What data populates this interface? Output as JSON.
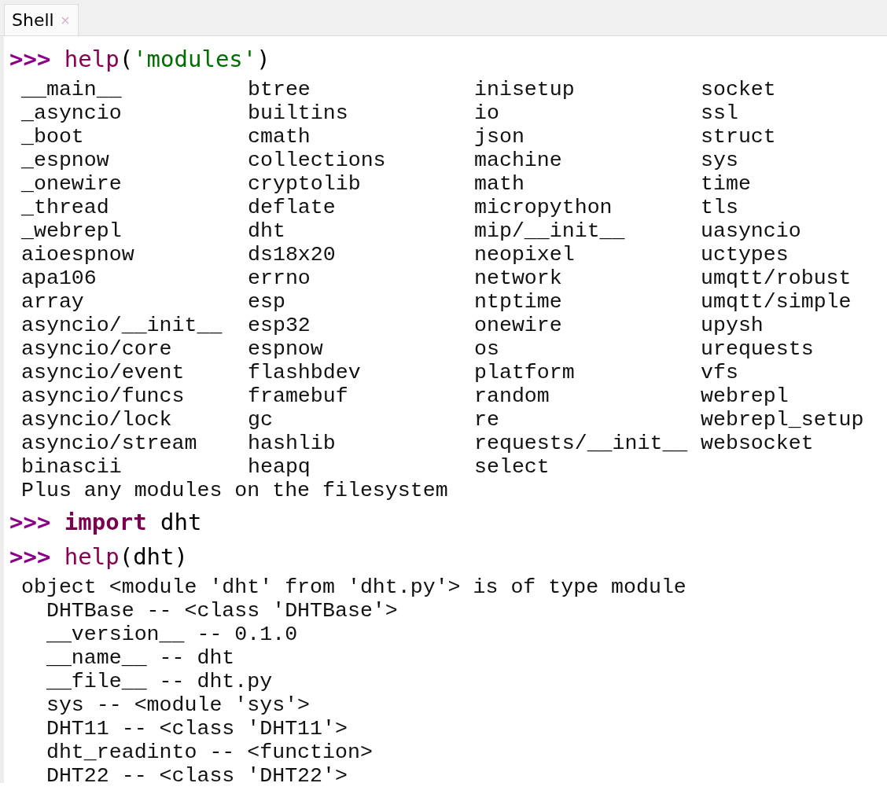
{
  "tabs": [
    {
      "label": "Shell",
      "selected": true,
      "closable": true
    }
  ],
  "shell": [
    {
      "kind": "input",
      "prompt": ">>>",
      "tokens": [
        {
          "text": "help",
          "kind": "builtin"
        },
        {
          "text": "(",
          "kind": "plain"
        },
        {
          "text": "'modules'",
          "kind": "string"
        },
        {
          "text": ")",
          "kind": "plain"
        }
      ]
    },
    {
      "kind": "columns",
      "rows": [
        [
          "__main__",
          "btree",
          "inisetup",
          "socket"
        ],
        [
          "_asyncio",
          "builtins",
          "io",
          "ssl"
        ],
        [
          "_boot",
          "cmath",
          "json",
          "struct"
        ],
        [
          "_espnow",
          "collections",
          "machine",
          "sys"
        ],
        [
          "_onewire",
          "cryptolib",
          "math",
          "time"
        ],
        [
          "_thread",
          "deflate",
          "micropython",
          "tls"
        ],
        [
          "_webrepl",
          "dht",
          "mip/__init__",
          "uasyncio"
        ],
        [
          "aioespnow",
          "ds18x20",
          "neopixel",
          "uctypes"
        ],
        [
          "apa106",
          "errno",
          "network",
          "umqtt/robust"
        ],
        [
          "array",
          "esp",
          "ntptime",
          "umqtt/simple"
        ],
        [
          "asyncio/__init__",
          "esp32",
          "onewire",
          "upysh"
        ],
        [
          "asyncio/core",
          "espnow",
          "os",
          "urequests"
        ],
        [
          "asyncio/event",
          "flashbdev",
          "platform",
          "vfs"
        ],
        [
          "asyncio/funcs",
          "framebuf",
          "random",
          "webrepl"
        ],
        [
          "asyncio/lock",
          "gc",
          "re",
          "webrepl_setup"
        ],
        [
          "asyncio/stream",
          "hashlib",
          "requests/__init__",
          "websocket"
        ],
        [
          "binascii",
          "heapq",
          "select"
        ]
      ]
    },
    {
      "kind": "output",
      "lines": [
        "Plus any modules on the filesystem"
      ]
    },
    {
      "kind": "input",
      "prompt": ">>>",
      "tokens": [
        {
          "text": "import",
          "kind": "keyword"
        },
        {
          "text": " dht",
          "kind": "plain"
        }
      ]
    },
    {
      "kind": "input",
      "prompt": ">>>",
      "tokens": [
        {
          "text": "help",
          "kind": "builtin"
        },
        {
          "text": "(dht)",
          "kind": "plain"
        }
      ]
    },
    {
      "kind": "output",
      "lines": [
        "object <module 'dht' from 'dht.py'> is of type module",
        "  DHTBase -- <class 'DHTBase'>",
        "  __version__ -- 0.1.0",
        "  __name__ -- dht",
        "  __file__ -- dht.py",
        "  sys -- <module 'sys'>",
        "  DHT11 -- <class 'DHT11'>",
        "  dht_readinto -- <function>",
        "  DHT22 -- <class 'DHT22'>"
      ]
    }
  ]
}
